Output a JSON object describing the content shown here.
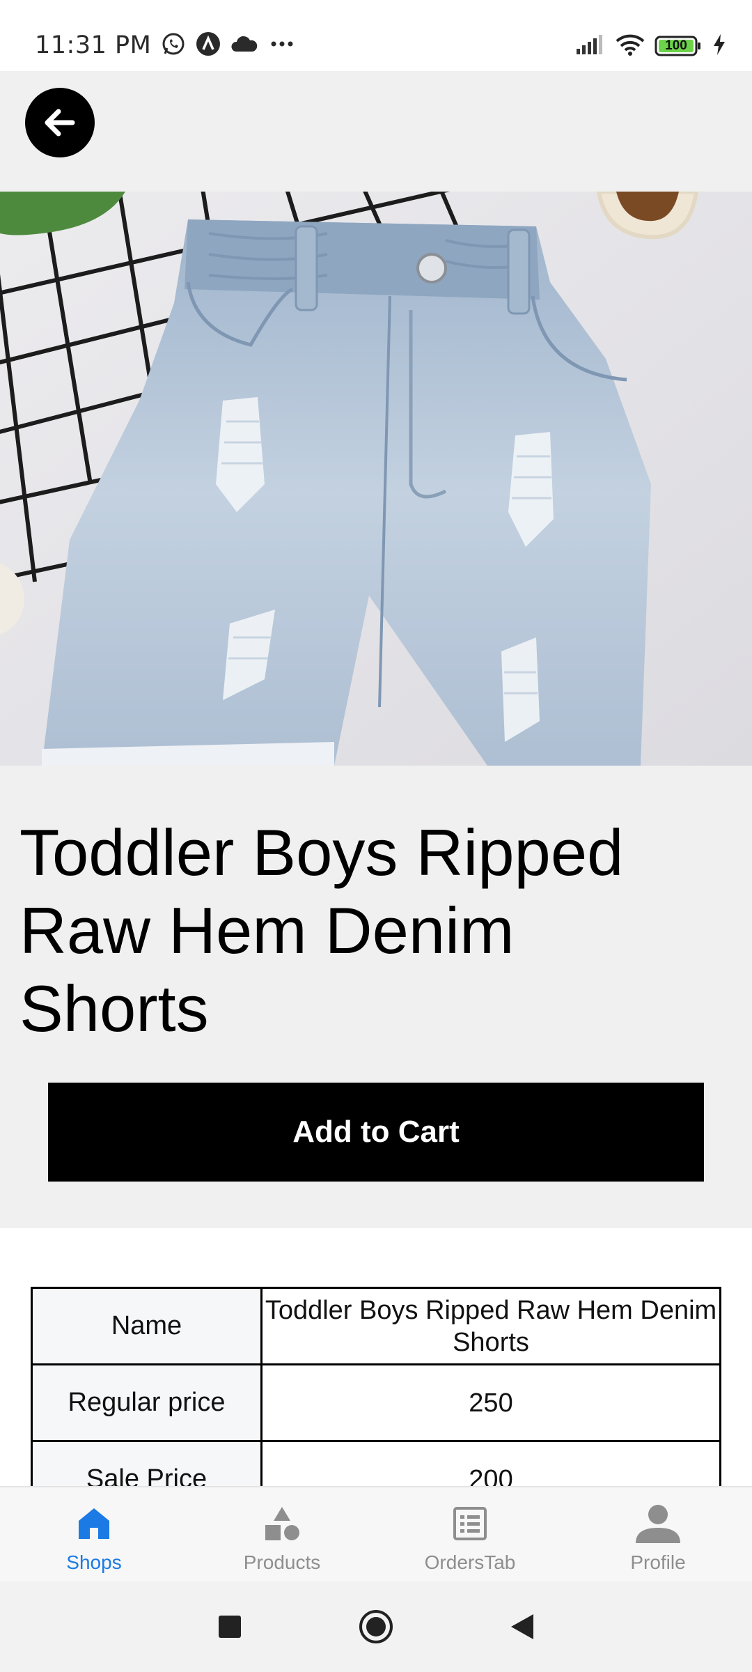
{
  "status_bar": {
    "time": "11:31 PM",
    "battery_level": "100",
    "icons": [
      "whatsapp-icon",
      "app-icon",
      "cloud-icon",
      "more-icon",
      "signal-icon",
      "wifi-icon",
      "battery-icon",
      "charging-icon"
    ]
  },
  "product": {
    "title": "Toddler Boys Ripped Raw Hem Denim Shorts",
    "add_to_cart_label": "Add to Cart",
    "details": [
      {
        "key": "Name",
        "value": "Toddler Boys Ripped Raw Hem Denim Shorts"
      },
      {
        "key": "Regular price",
        "value": "250"
      },
      {
        "key": "Sale Price",
        "value": "200"
      }
    ]
  },
  "bottom_nav": {
    "items": [
      {
        "label": "Shops",
        "icon": "home-icon",
        "active": true
      },
      {
        "label": "Products",
        "icon": "shapes-icon",
        "active": false
      },
      {
        "label": "OrdersTab",
        "icon": "list-icon",
        "active": false
      },
      {
        "label": "Profile",
        "icon": "person-icon",
        "active": false
      }
    ]
  },
  "colors": {
    "accent": "#1b7ae4",
    "inactive": "#8e8e8e",
    "button_bg": "#000000"
  }
}
